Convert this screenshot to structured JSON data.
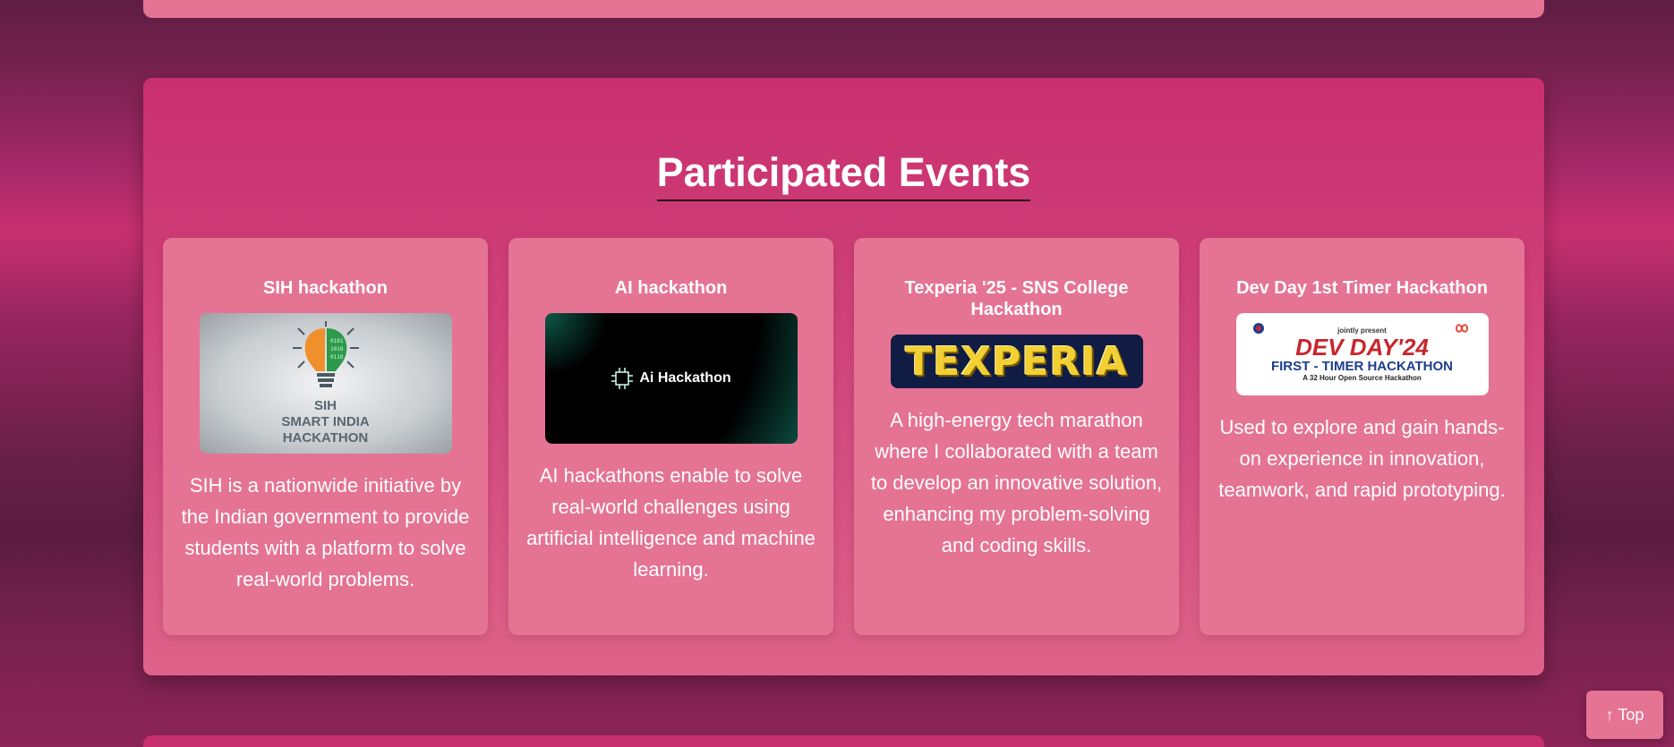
{
  "section": {
    "title": "Participated Events"
  },
  "events": [
    {
      "title": "SIH hackathon",
      "image_text": [
        "SIH",
        "SMART INDIA",
        "HACKATHON"
      ],
      "description": "SIH is a nationwide initiative by the Indian government to provide students with a platform to solve real-world problems."
    },
    {
      "title": "AI hackathon",
      "image_text": [
        "Ai Hackathon"
      ],
      "description": "AI hackathons enable to solve real-world challenges using artificial intelligence and machine learning."
    },
    {
      "title": "Texperia '25 - SNS College Hackathon",
      "image_text": [
        "TEXPERIA"
      ],
      "description": "A high-energy tech marathon where I collaborated with a team to develop an innovative solution, enhancing my problem-solving and coding skills."
    },
    {
      "title": "Dev Day 1st Timer Hackathon",
      "image_text": [
        "jointly present",
        "DEV DAY'24",
        "FIRST - TIMER HACKATHON",
        "A 32 Hour Open Source Hackathon"
      ],
      "description": "Used to explore and gain hands-on experience in innovation, teamwork, and rapid prototyping."
    }
  ],
  "scroll_top": {
    "label": "↑ Top"
  },
  "colors": {
    "card": "#e57394",
    "section": "#c92e6e",
    "accent_gold": "#f2cf32"
  }
}
